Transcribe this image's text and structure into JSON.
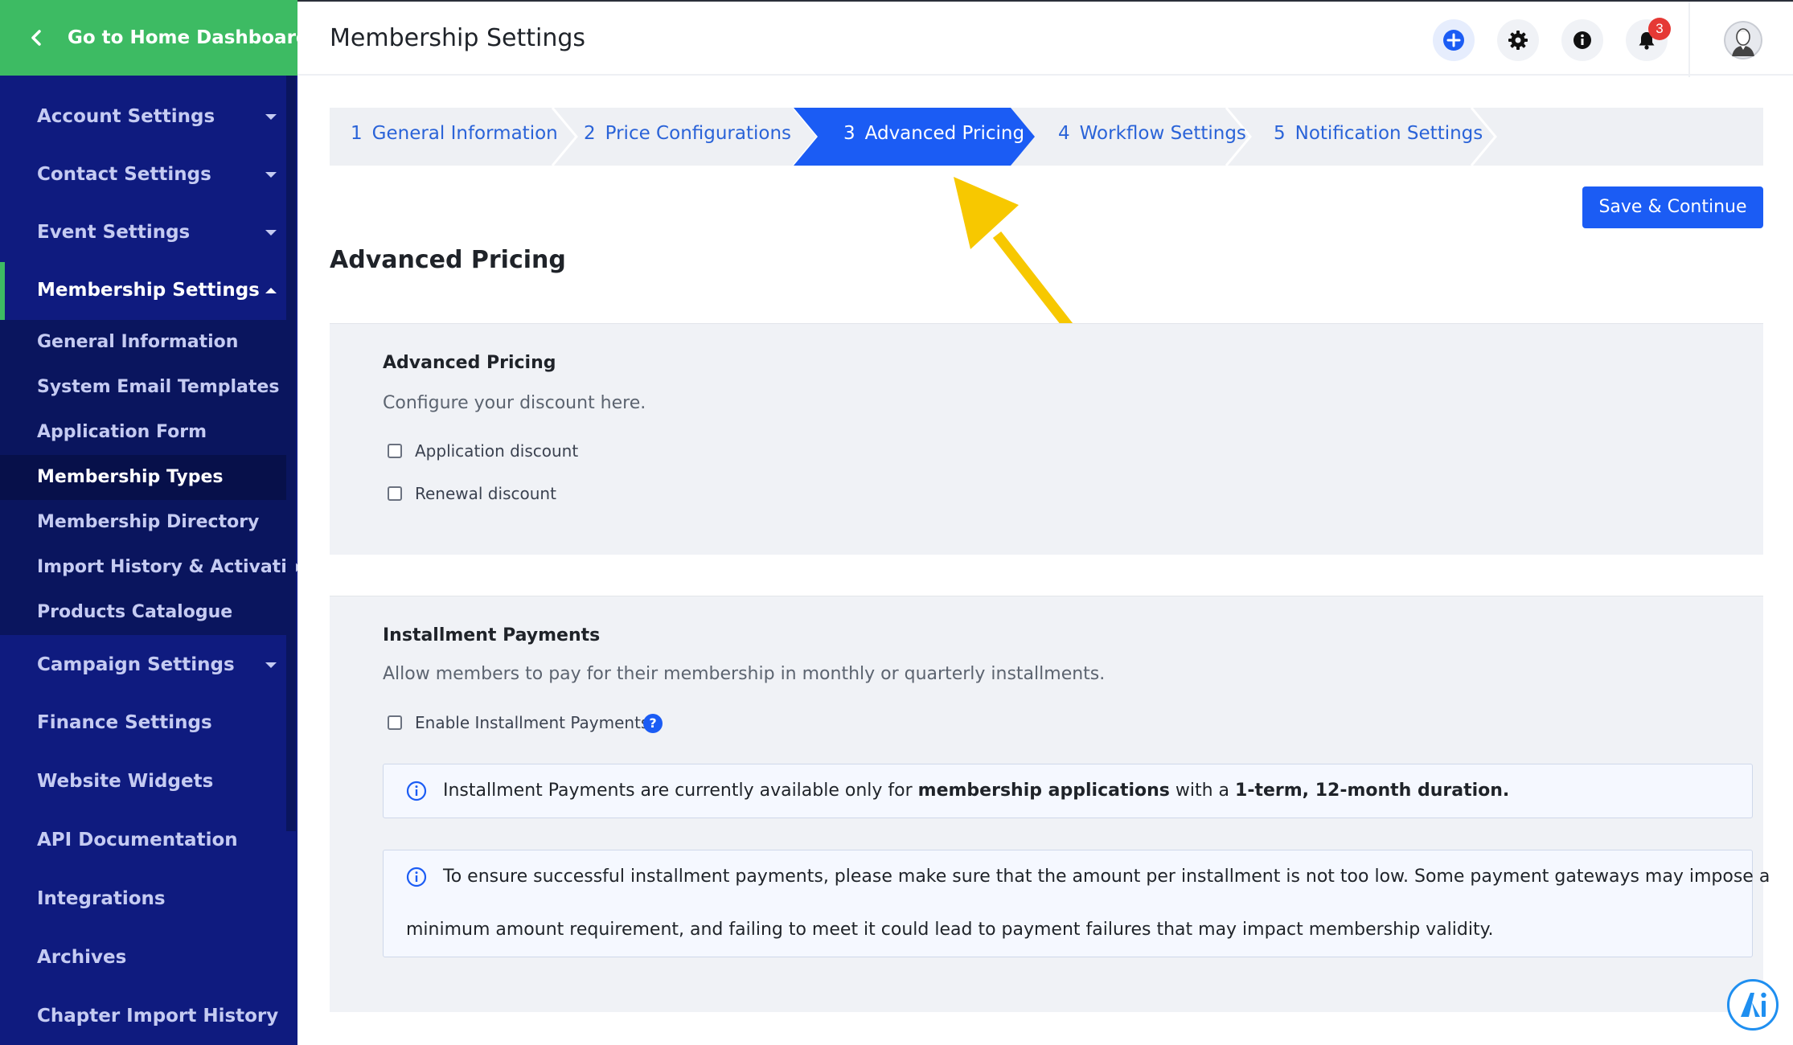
{
  "sidebar": {
    "home_label": "Go to Home Dashboard",
    "items": [
      {
        "label": "Account Settings"
      },
      {
        "label": "Contact Settings"
      },
      {
        "label": "Event Settings"
      },
      {
        "label": "Membership Settings"
      },
      {
        "label": "Campaign Settings"
      },
      {
        "label": "Finance Settings"
      },
      {
        "label": "Website Widgets"
      },
      {
        "label": "API Documentation"
      },
      {
        "label": "Integrations"
      },
      {
        "label": "Archives"
      },
      {
        "label": "Chapter Import History"
      }
    ],
    "submenu": [
      {
        "label": "General Information"
      },
      {
        "label": "System Email Templates"
      },
      {
        "label": "Application Form"
      },
      {
        "label": "Membership Types"
      },
      {
        "label": "Membership Directory"
      },
      {
        "label": "Import History & Activation"
      },
      {
        "label": "Products Catalogue"
      }
    ]
  },
  "header": {
    "title": "Membership Settings",
    "notification_count": "3",
    "icons": [
      "add-icon",
      "gear-icon",
      "info-icon",
      "bell-icon",
      "avatar"
    ]
  },
  "steps": [
    {
      "num": "1",
      "label": "General Information"
    },
    {
      "num": "2",
      "label": "Price Configurations"
    },
    {
      "num": "3",
      "label": "Advanced Pricing"
    },
    {
      "num": "4",
      "label": "Workflow Settings"
    },
    {
      "num": "5",
      "label": "Notification Settings"
    }
  ],
  "main": {
    "save_label": "Save & Continue",
    "section_title": "Advanced Pricing",
    "advanced": {
      "heading": "Advanced Pricing",
      "description": "Configure your discount here.",
      "options": [
        "Application discount",
        "Renewal discount"
      ]
    },
    "installment": {
      "heading": "Installment Payments",
      "description": "Allow members to pay for their membership in monthly or quarterly installments.",
      "enable_label": "Enable Installment Payments",
      "help": "?",
      "info1": {
        "pre": "Installment Payments are currently available only for ",
        "bold1": "membership applications",
        "mid": " with a ",
        "bold2": "1-term, 12-month duration."
      },
      "info2": {
        "line1": "To ensure successful installment payments, please make sure that the amount per installment is not too low. Some payment gateways may impose a",
        "line2": "minimum amount requirement, and failing to meet it could lead to payment failures that may impact membership validity."
      }
    }
  },
  "colors": {
    "sidebar_bg": "#0f1b7f",
    "home_green": "#3dbb63",
    "primary_blue": "#1b5cf4",
    "arrow_yellow": "#f7c800"
  }
}
